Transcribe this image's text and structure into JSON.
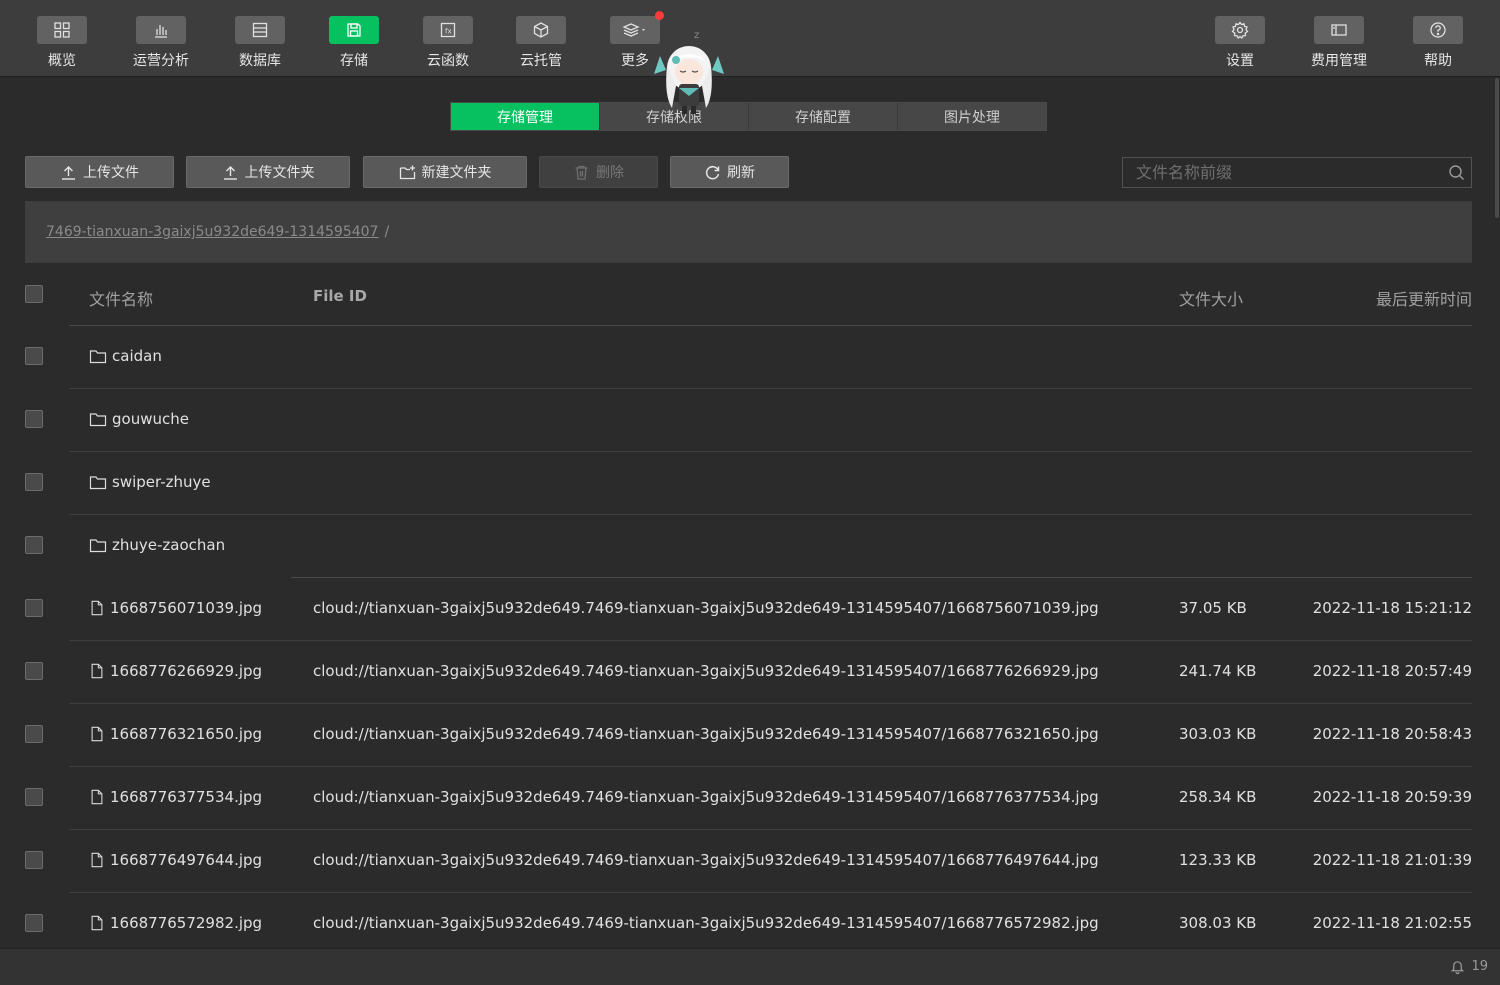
{
  "toolbar": {
    "left": [
      {
        "label": "概览",
        "icon": "grid-icon"
      },
      {
        "label": "运营分析",
        "icon": "bar-chart-icon"
      },
      {
        "label": "数据库",
        "icon": "database-icon"
      },
      {
        "label": "存储",
        "icon": "save-icon",
        "active": true
      },
      {
        "label": "云函数",
        "icon": "function-icon"
      },
      {
        "label": "云托管",
        "icon": "cube-icon"
      },
      {
        "label": "更多",
        "icon": "layers-icon",
        "has_dot": true
      }
    ],
    "right": [
      {
        "label": "设置",
        "icon": "gear-icon"
      },
      {
        "label": "费用管理",
        "icon": "billing-icon"
      },
      {
        "label": "帮助",
        "icon": "help-icon"
      }
    ]
  },
  "tabs": [
    {
      "label": "存储管理",
      "active": true
    },
    {
      "label": "存储权限"
    },
    {
      "label": "存储配置"
    },
    {
      "label": "图片处理"
    }
  ],
  "actions": {
    "upload_file": "上传文件",
    "upload_folder": "上传文件夹",
    "new_folder": "新建文件夹",
    "delete": "删除",
    "refresh": "刷新"
  },
  "search": {
    "placeholder": "文件名称前缀",
    "value": ""
  },
  "breadcrumb": {
    "path": "7469-tianxuan-3gaixj5u932de649-1314595407",
    "separator": "/"
  },
  "table": {
    "headers": {
      "name": "文件名称",
      "file_id": "File ID",
      "size": "文件大小",
      "updated": "最后更新时间"
    },
    "folders": [
      {
        "name": "caidan"
      },
      {
        "name": "gouwuche"
      },
      {
        "name": "swiper-zhuye"
      },
      {
        "name": "zhuye-zaochan"
      }
    ],
    "files": [
      {
        "name": "1668756071039.jpg",
        "file_id": "cloud://tianxuan-3gaixj5u932de649.7469-tianxuan-3gaixj5u932de649-1314595407/1668756071039.jpg",
        "size": "37.05 KB",
        "updated": "2022-11-18 15:21:12"
      },
      {
        "name": "1668776266929.jpg",
        "file_id": "cloud://tianxuan-3gaixj5u932de649.7469-tianxuan-3gaixj5u932de649-1314595407/1668776266929.jpg",
        "size": "241.74 KB",
        "updated": "2022-11-18 20:57:49"
      },
      {
        "name": "1668776321650.jpg",
        "file_id": "cloud://tianxuan-3gaixj5u932de649.7469-tianxuan-3gaixj5u932de649-1314595407/1668776321650.jpg",
        "size": "303.03 KB",
        "updated": "2022-11-18 20:58:43"
      },
      {
        "name": "1668776377534.jpg",
        "file_id": "cloud://tianxuan-3gaixj5u932de649.7469-tianxuan-3gaixj5u932de649-1314595407/1668776377534.jpg",
        "size": "258.34 KB",
        "updated": "2022-11-18 20:59:39"
      },
      {
        "name": "1668776497644.jpg",
        "file_id": "cloud://tianxuan-3gaixj5u932de649.7469-tianxuan-3gaixj5u932de649-1314595407/1668776497644.jpg",
        "size": "123.33 KB",
        "updated": "2022-11-18 21:01:39"
      },
      {
        "name": "1668776572982.jpg",
        "file_id": "cloud://tianxuan-3gaixj5u932de649.7469-tianxuan-3gaixj5u932de649-1314595407/1668776572982.jpg",
        "size": "308.03 KB",
        "updated": "2022-11-18 21:02:55"
      }
    ]
  },
  "status": {
    "notification_count": "19",
    "icon": "bell-icon"
  },
  "colors": {
    "accent": "#07c160",
    "background": "#2b2b2b",
    "toolbar": "#3d3d3d",
    "badge": "#ff3b3b"
  }
}
